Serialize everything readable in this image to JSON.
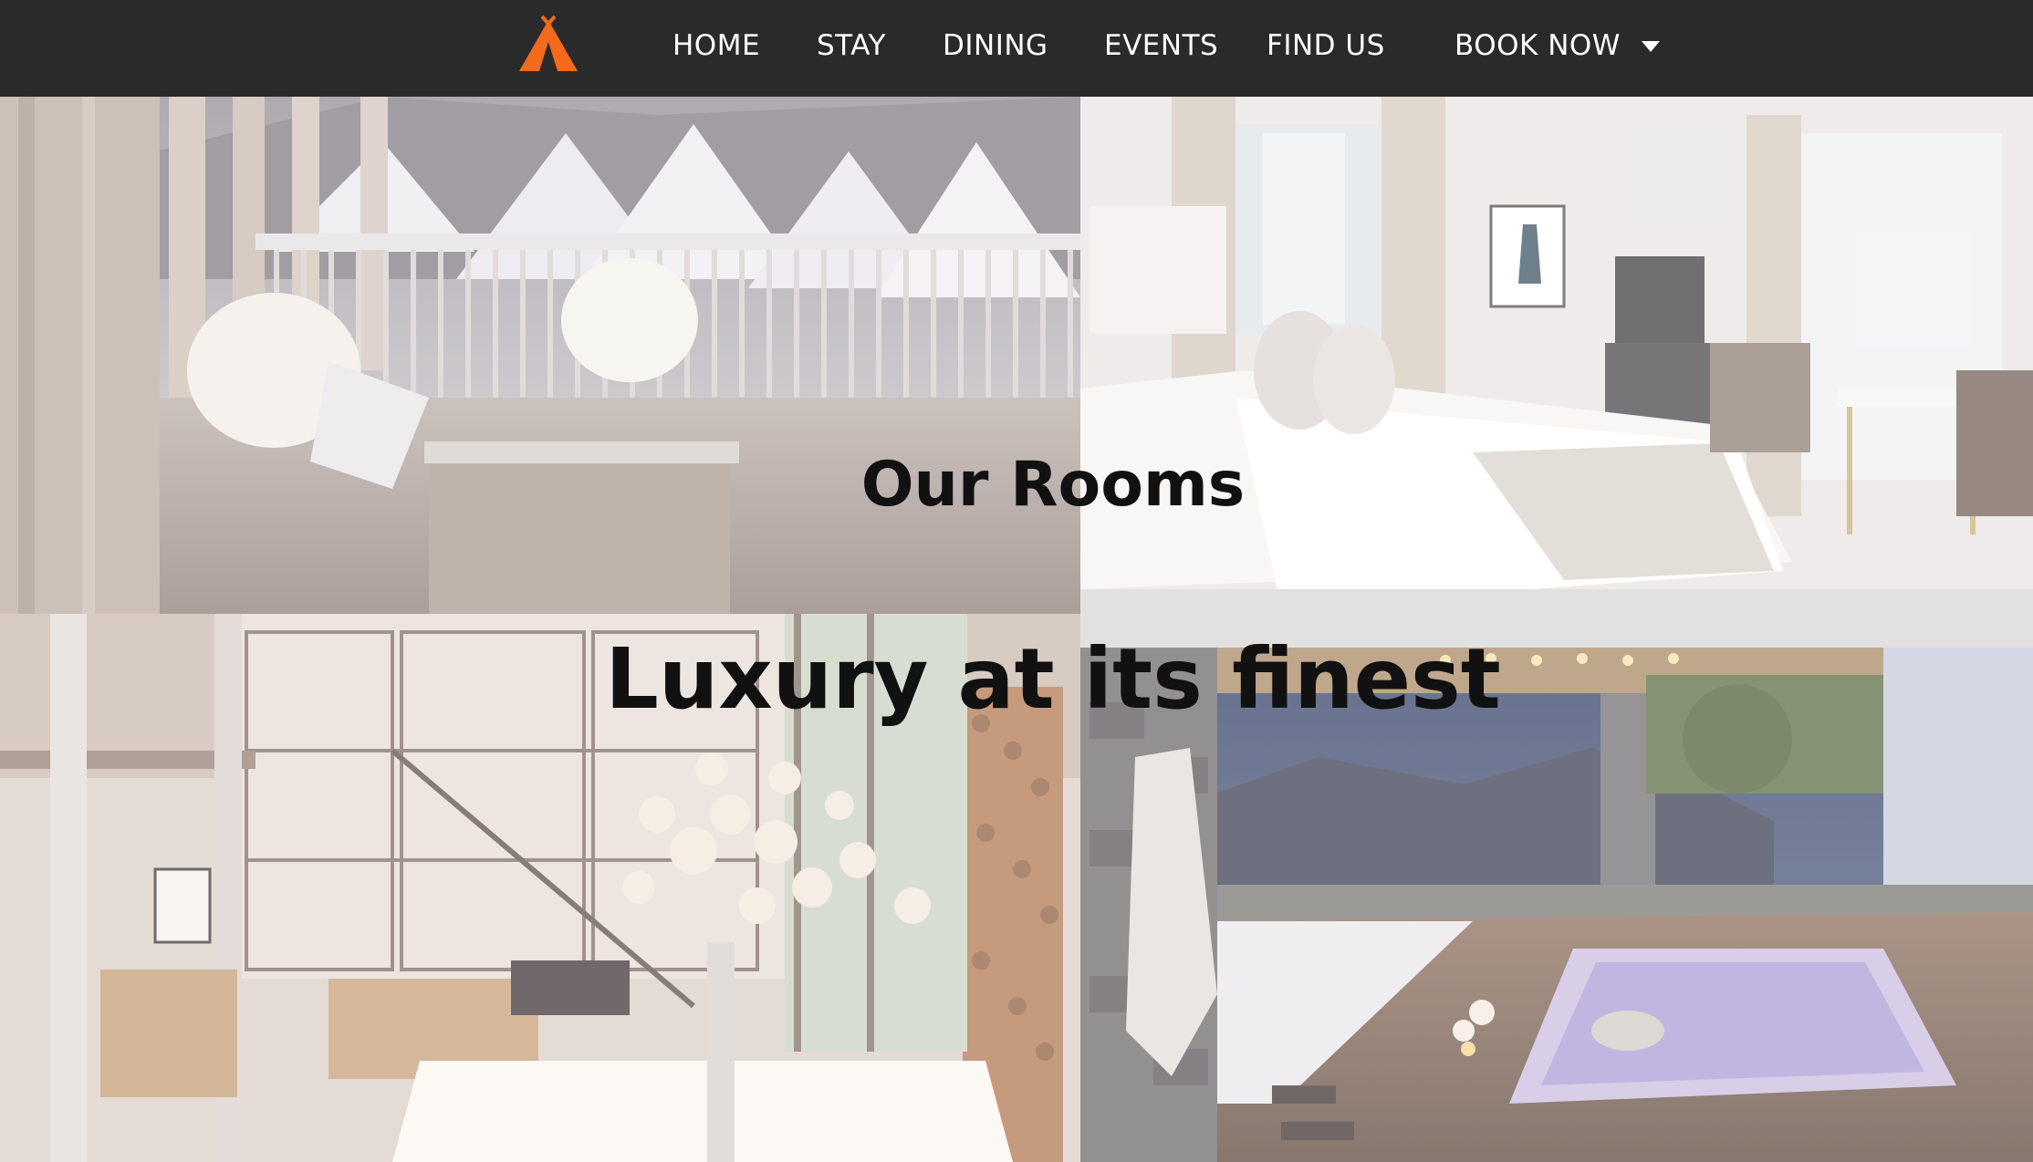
{
  "nav": {
    "logo_icon": "orange-tent-logo-icon",
    "items": [
      {
        "label": "HOME"
      },
      {
        "label": "STAY"
      },
      {
        "label": "DINING"
      },
      {
        "label": "EVENTS"
      },
      {
        "label": "FIND US"
      }
    ],
    "book_now": {
      "label": "BOOK NOW",
      "icon": "caret-down-icon"
    }
  },
  "hero": {
    "subtitle": "Our Rooms",
    "title": "Luxury at its finest"
  },
  "colors": {
    "navbar_bg": "#2a2a2a",
    "nav_text": "#ffffff",
    "logo_orange": "#f26a1b",
    "hero_text": "#111111"
  },
  "photos": [
    {
      "name": "snowy-balcony-photo"
    },
    {
      "name": "white-bedroom-photo"
    },
    {
      "name": "loft-living-room-photo"
    },
    {
      "name": "hot-tub-terrace-photo"
    }
  ]
}
